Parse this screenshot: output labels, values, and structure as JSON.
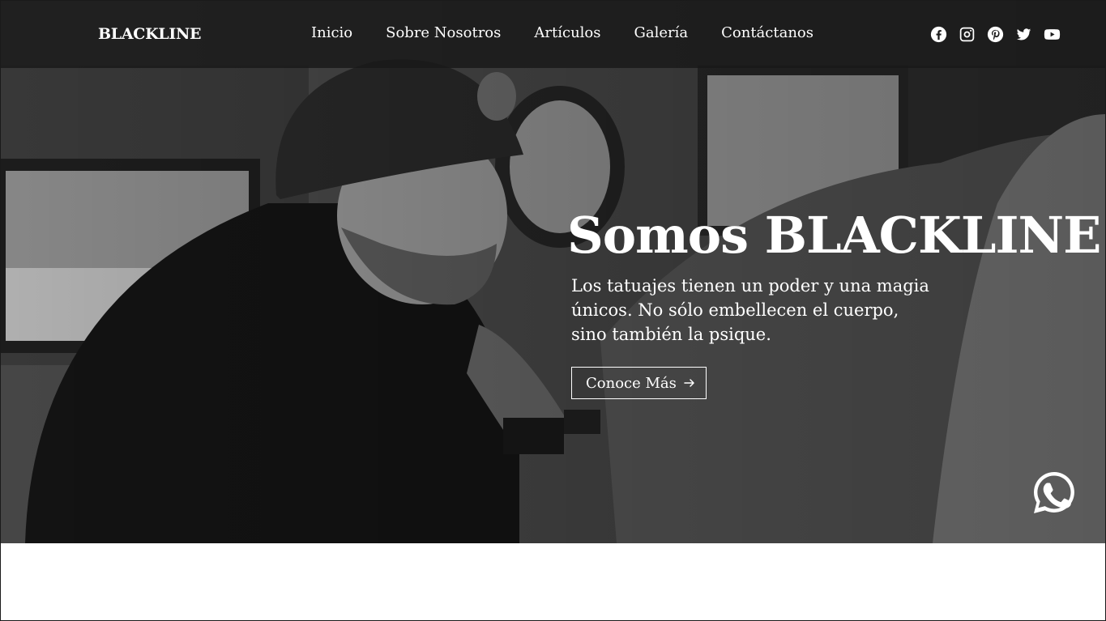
{
  "brand": "BLACKLINE",
  "nav": {
    "links": [
      "Inicio",
      "Sobre Nosotros",
      "Artículos",
      "Galería",
      "Contáctanos"
    ]
  },
  "social": [
    "facebook-icon",
    "instagram-icon",
    "pinterest-icon",
    "twitter-icon",
    "youtube-icon"
  ],
  "hero": {
    "title": "Somos BLACKLINE",
    "text": "Los tatuajes tienen un poder y una magia únicos. No sólo embellecen el cuerpo, sino también la psique.",
    "cta_label": "Conoce Más",
    "cta_icon": "arrow-right-icon"
  },
  "floating": {
    "icon": "whatsapp-icon"
  },
  "colors": {
    "nav_bg": "#191919",
    "text": "#ffffff",
    "page_bg": "#ffffff"
  }
}
